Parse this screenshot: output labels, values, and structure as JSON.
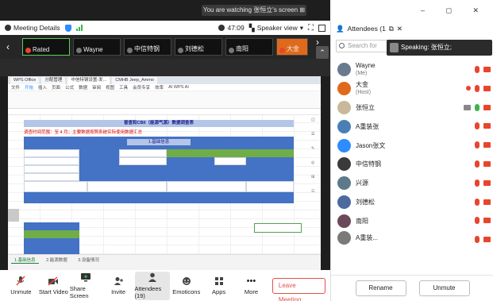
{
  "banner": {
    "text": "You are watching 张恒立's screen  ⊞"
  },
  "topbar": {
    "meeting_details": "Meeting Details",
    "timer": "47:09",
    "speaker_view": "Speaker view"
  },
  "thumbnails": [
    {
      "label": "Rated",
      "style": "active"
    },
    {
      "label": "Wayne",
      "style": "normal"
    },
    {
      "label": "中信特钢",
      "style": "normal"
    },
    {
      "label": "刘德松",
      "style": "normal"
    },
    {
      "label": "南阳",
      "style": "normal"
    },
    {
      "label": "大金",
      "style": "orange"
    }
  ],
  "toolbar": {
    "unmute": "Unmute",
    "start_video": "Start Video",
    "share_screen": "Share Screen",
    "invite": "Invite",
    "attendees": "Attendees (19)",
    "emoticons": "Emoticons",
    "apps": "Apps",
    "more": "More",
    "leave": "Leave Meeting"
  },
  "panel": {
    "title": "Attendees (1",
    "search_placeholder": "Search for",
    "speaking": "Speaking: 张恒立;",
    "rename": "Rename",
    "unmute": "Unmute",
    "attendees": [
      {
        "name": "Wayne",
        "sub": "(Me)",
        "color": "#6b7a8f"
      },
      {
        "name": "大金",
        "sub": "(Host)",
        "color": "#e06a1a"
      },
      {
        "name": "张恒立",
        "sub": "",
        "color": "#c9b89a"
      },
      {
        "name": "A重装张",
        "sub": "",
        "color": "#4a7fb5"
      },
      {
        "name": "Jason张文",
        "sub": "",
        "color": "#2d8cff"
      },
      {
        "name": "中信特钢",
        "sub": "",
        "color": "#3a3a3a"
      },
      {
        "name": "兴源",
        "sub": "",
        "color": "#5d7a8a"
      },
      {
        "name": "刘德松",
        "sub": "",
        "color": "#4b6aa0"
      },
      {
        "name": "南阳",
        "sub": "",
        "color": "#6a4a5a"
      },
      {
        "name": "A重装...",
        "sub": "",
        "color": "#7a7a7a"
      }
    ]
  },
  "screen": {
    "tabs": [
      "WPS Office",
      "分配管理",
      "中信特钢设置-发...",
      "CMHB Jeep_Ammo"
    ],
    "menu": [
      "文件",
      "开始",
      "插入",
      "页面",
      "公式",
      "数据",
      "审阅",
      "视图",
      "工具",
      "会员专享",
      "效率",
      "AI WPS AI"
    ],
    "sheet_title": "普查和CBII（能源气源）数据调查表",
    "red_note": "调查时间范围：至 4 月；主要数据按照系统实际使用数据汇总",
    "section_header": "1.基础信息",
    "sheet_tabs": [
      "1.基础信息",
      "2.能源数据",
      "3.设备情况"
    ]
  }
}
